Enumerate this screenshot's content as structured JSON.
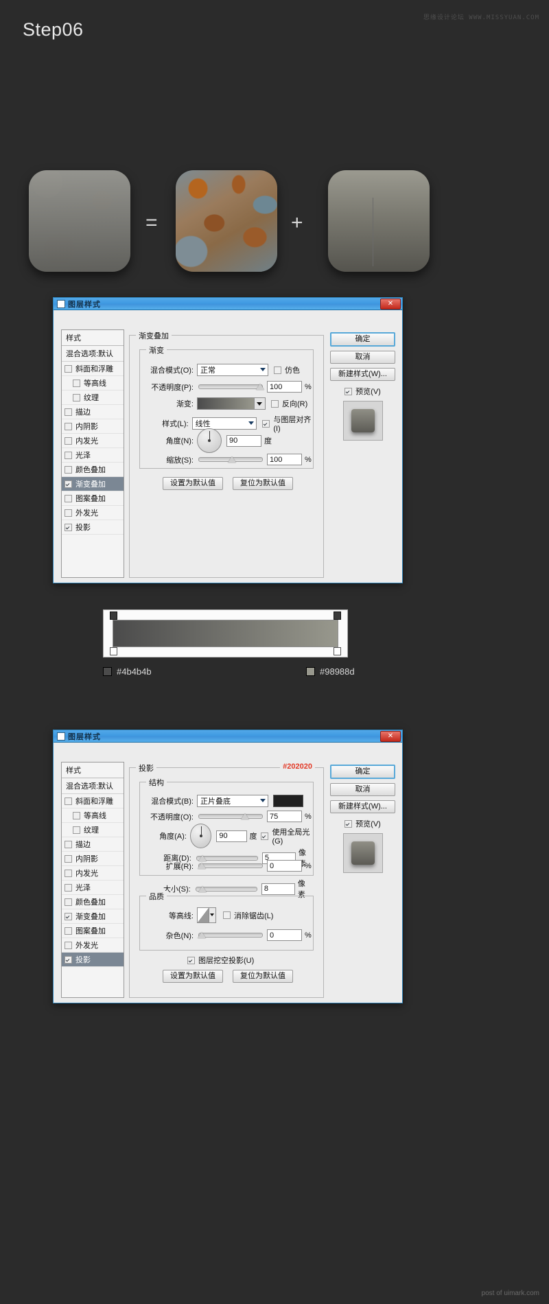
{
  "header": {
    "step_title": "Step06",
    "watermark": "思缘设计论坛 WWW.MISSYUAN.COM"
  },
  "icon_row": {
    "equals": "=",
    "plus": "+",
    "icon1_name": "result-icon-preview",
    "icon2_name": "rust-texture-icon",
    "icon3_name": "gray-gradient-icon"
  },
  "dialog1": {
    "title": "图层样式",
    "close_label": "✕",
    "styles_header": "样式",
    "blending_options": "混合选项:默认",
    "style_items": [
      {
        "label": "斜面和浮雕",
        "checked": false,
        "indent": false,
        "selected": false
      },
      {
        "label": "等高线",
        "checked": false,
        "indent": true,
        "selected": false
      },
      {
        "label": "纹理",
        "checked": false,
        "indent": true,
        "selected": false
      },
      {
        "label": "描边",
        "checked": false,
        "indent": false,
        "selected": false
      },
      {
        "label": "内阴影",
        "checked": false,
        "indent": false,
        "selected": false
      },
      {
        "label": "内发光",
        "checked": false,
        "indent": false,
        "selected": false
      },
      {
        "label": "光泽",
        "checked": false,
        "indent": false,
        "selected": false
      },
      {
        "label": "颜色叠加",
        "checked": false,
        "indent": false,
        "selected": false
      },
      {
        "label": "渐变叠加",
        "checked": true,
        "indent": false,
        "selected": true
      },
      {
        "label": "图案叠加",
        "checked": false,
        "indent": false,
        "selected": false
      },
      {
        "label": "外发光",
        "checked": false,
        "indent": false,
        "selected": false
      },
      {
        "label": "投影",
        "checked": true,
        "indent": false,
        "selected": false
      }
    ],
    "group_title": "渐变叠加",
    "subgroup_title": "渐变",
    "blend_mode_label": "混合模式(O):",
    "blend_mode_value": "正常",
    "dither_label": "仿色",
    "dither_checked": false,
    "opacity_label": "不透明度(P):",
    "opacity_value": "100",
    "opacity_unit": "%",
    "gradient_label": "渐变:",
    "reverse_label": "反向(R)",
    "reverse_checked": false,
    "style_label": "样式(L):",
    "style_value": "线性",
    "align_label": "与图层对齐(I)",
    "align_checked": true,
    "angle_label": "角度(N):",
    "angle_value": "90",
    "angle_unit": "度",
    "scale_label": "缩放(S):",
    "scale_value": "100",
    "scale_unit": "%",
    "set_default_btn": "设置为默认值",
    "reset_default_btn": "复位为默认值",
    "ok_btn": "确定",
    "cancel_btn": "取消",
    "new_style_btn": "新建样式(W)...",
    "preview_label": "预览(V)",
    "preview_checked": true,
    "gradient_from": "#4b4b4b",
    "gradient_to": "#98988d"
  },
  "gradient_editor": {
    "left_swatch_hex": "#4b4b4b",
    "right_swatch_hex": "#98988d"
  },
  "dialog2": {
    "title": "图层样式",
    "close_label": "✕",
    "styles_header": "样式",
    "blending_options": "混合选项:默认",
    "style_items": [
      {
        "label": "斜面和浮雕",
        "checked": false,
        "indent": false,
        "selected": false
      },
      {
        "label": "等高线",
        "checked": false,
        "indent": true,
        "selected": false
      },
      {
        "label": "纹理",
        "checked": false,
        "indent": true,
        "selected": false
      },
      {
        "label": "描边",
        "checked": false,
        "indent": false,
        "selected": false
      },
      {
        "label": "内阴影",
        "checked": false,
        "indent": false,
        "selected": false
      },
      {
        "label": "内发光",
        "checked": false,
        "indent": false,
        "selected": false
      },
      {
        "label": "光泽",
        "checked": false,
        "indent": false,
        "selected": false
      },
      {
        "label": "颜色叠加",
        "checked": false,
        "indent": false,
        "selected": false
      },
      {
        "label": "渐变叠加",
        "checked": true,
        "indent": false,
        "selected": false
      },
      {
        "label": "图案叠加",
        "checked": false,
        "indent": false,
        "selected": false
      },
      {
        "label": "外发光",
        "checked": false,
        "indent": false,
        "selected": false
      },
      {
        "label": "投影",
        "checked": true,
        "indent": false,
        "selected": true
      }
    ],
    "group_title": "投影",
    "subgroup_title": "结构",
    "color_annotation": "#202020",
    "blend_mode_label": "混合模式(B):",
    "blend_mode_value": "正片叠底",
    "shadow_color": "#202020",
    "opacity_label": "不透明度(O):",
    "opacity_value": "75",
    "opacity_unit": "%",
    "angle_label": "角度(A):",
    "angle_value": "90",
    "angle_unit": "度",
    "global_light_label": "使用全局光(G)",
    "global_light_checked": true,
    "distance_label": "距离(D):",
    "distance_value": "5",
    "distance_unit": "像素",
    "spread_label": "扩展(R):",
    "spread_value": "0",
    "spread_unit": "%",
    "size_label": "大小(S):",
    "size_value": "8",
    "size_unit": "像素",
    "quality_title": "品质",
    "contour_label": "等高线:",
    "antialias_label": "消除锯齿(L)",
    "antialias_checked": false,
    "noise_label": "杂色(N):",
    "noise_value": "0",
    "noise_unit": "%",
    "knockout_label": "图层挖空投影(U)",
    "knockout_checked": true,
    "set_default_btn": "设置为默认值",
    "reset_default_btn": "复位为默认值",
    "ok_btn": "确定",
    "cancel_btn": "取消",
    "new_style_btn": "新建样式(W)...",
    "preview_label": "预览(V)",
    "preview_checked": true
  },
  "footer": "post of uimark.com"
}
